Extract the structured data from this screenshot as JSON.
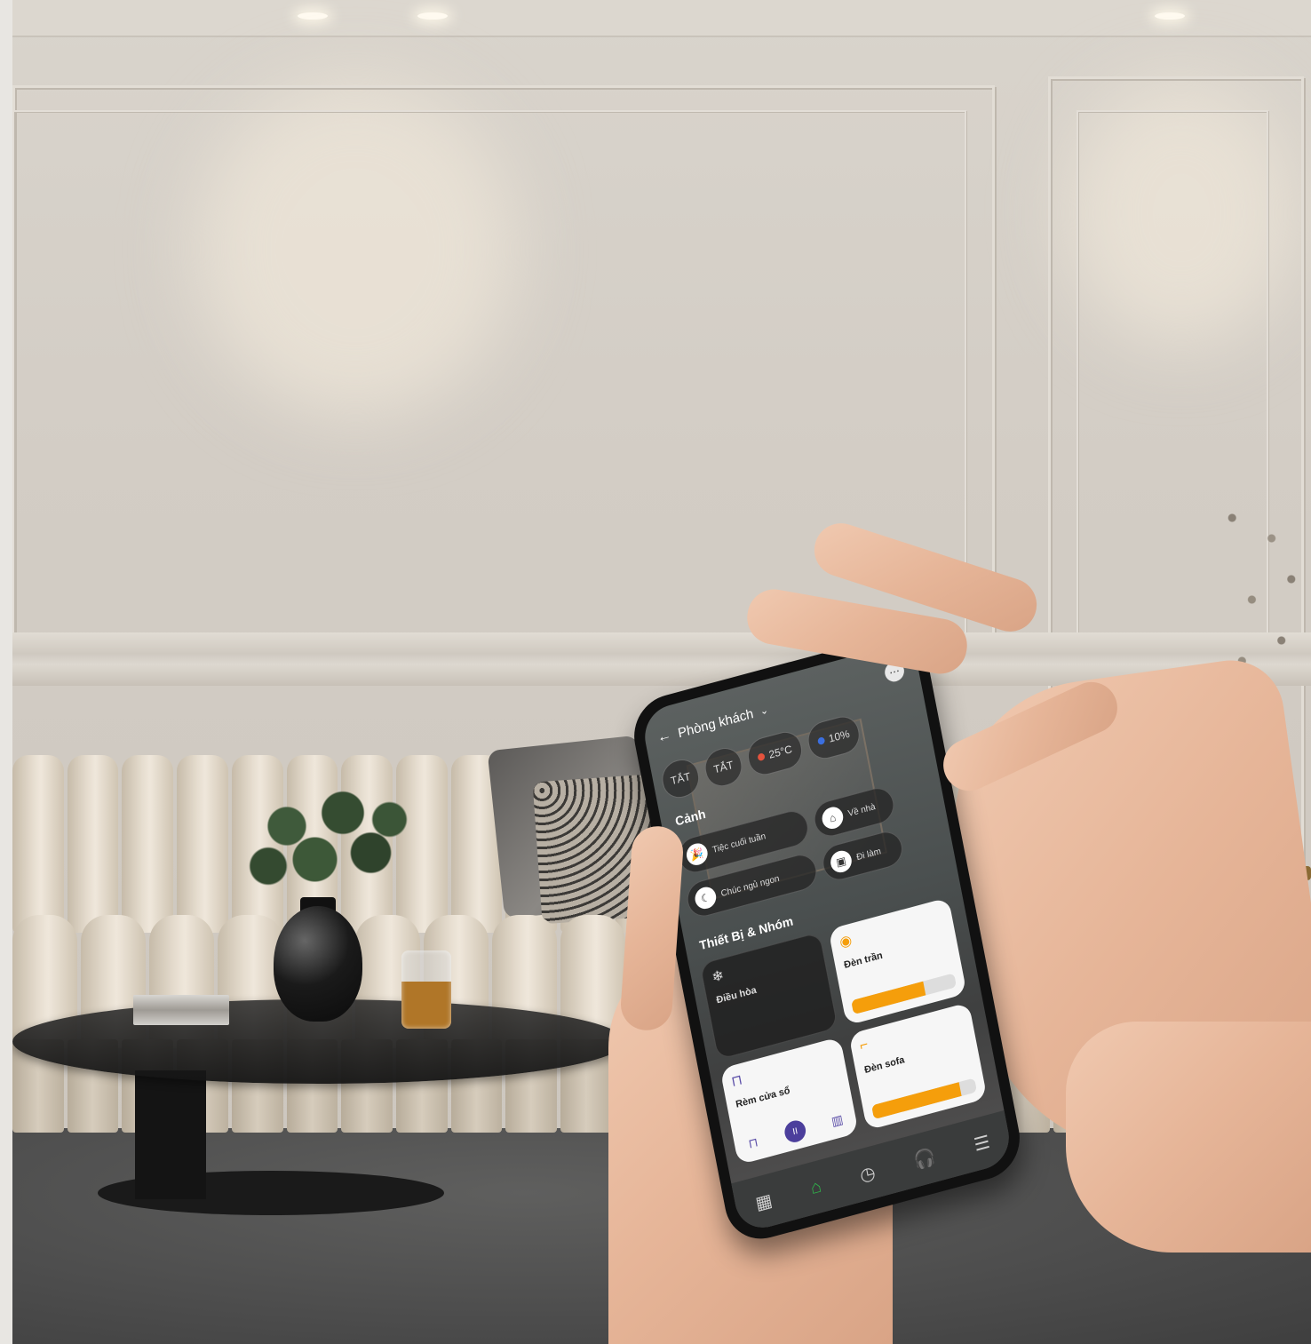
{
  "app": {
    "header": {
      "back_icon": "←",
      "title": "Phòng khách",
      "chevron": "⌄",
      "more_icon": "⋯"
    },
    "status_chips": [
      {
        "label": "TẮT"
      },
      {
        "label": "TẮT"
      },
      {
        "label": "25°C",
        "accent": "#e5533d"
      },
      {
        "label": "10%",
        "accent": "#3b6fe0"
      }
    ],
    "scenes_title": "Cảnh",
    "scenes": [
      {
        "icon": "🎉",
        "label": "Tiệc cuối tuần"
      },
      {
        "icon": "⌂",
        "label": "Về nhà"
      },
      {
        "icon": "☾",
        "label": "Chúc ngủ ngon"
      },
      {
        "icon": "▣",
        "label": "Đi làm"
      }
    ],
    "devices_title": "Thiết Bị & Nhóm",
    "devices": [
      {
        "name": "Điều hòa",
        "status": "",
        "icon": "❄",
        "theme": "dark"
      },
      {
        "name": "Đèn trần",
        "status": "",
        "icon": "◉",
        "theme": "light",
        "level": 0.7
      },
      {
        "name": "Rèm cửa sổ",
        "status": "",
        "icon": "⊓",
        "theme": "light"
      },
      {
        "name": "Đèn sofa",
        "status": "",
        "icon": "⌐",
        "theme": "light",
        "level": 0.85
      }
    ],
    "accent_orange": "#f59e0b",
    "accent_green": "#2fb34a",
    "bottom_nav": [
      "▦",
      "⌂",
      "◷",
      "🎧",
      "☰"
    ]
  }
}
